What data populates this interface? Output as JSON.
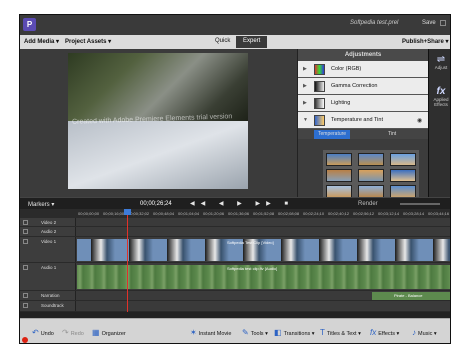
{
  "window": {
    "doc_title": "Softpedia test.prel",
    "save_label": "Save",
    "app_icon": "premiere-elements-icon"
  },
  "menu": {
    "add_media": "Add Media ▾",
    "project_assets": "Project Assets ▾",
    "quick": "Quick",
    "expert": "Expert",
    "publish_share": "Publish+Share ▾"
  },
  "monitor": {
    "watermark": "Created with Adobe Premiere Elements trial version"
  },
  "adjustments": {
    "title": "Adjustments",
    "items": [
      {
        "label": "Color (RGB)"
      },
      {
        "label": "Gamma Correction"
      },
      {
        "label": "Lighting"
      },
      {
        "label": "Temperature and Tint"
      }
    ],
    "tabs": [
      "Temperature",
      "Tint"
    ]
  },
  "rail": {
    "adjust": "Adjust",
    "applied_effects": "Applied Effects"
  },
  "timeline_bar": {
    "markers": "Markers ▾",
    "timecode": "00;00;26;24",
    "render": "Render"
  },
  "ruler": [
    "00;00;00;00",
    "00;00;16;00",
    "00;00;32;02",
    "00;00;48;04",
    "00;01;04;04",
    "00;01;20;06",
    "00;01;36;06",
    "00;01;52;08",
    "00;02;08;08",
    "00;02;24;10",
    "00;02;40;12",
    "00;02;56;12",
    "00;03;12;14",
    "00;03;28;14",
    "00;03;44;16"
  ],
  "tracks": [
    "Video 2",
    "Audio 2",
    "Video 1",
    "Audio 1",
    "Narration",
    "Soundtrack"
  ],
  "clip_labels": [
    "Softpedia Test Clip [Video]",
    "Softpedia test clip.flv [Audio]",
    "Pirate - Balance"
  ],
  "bottom": {
    "undo": "Undo",
    "redo": "Redo",
    "organizer": "Organizer",
    "instant_movie": "Instant Movie",
    "tools": "Tools ▾",
    "transitions": "Transitions ▾",
    "titles_text": "Titles & Text ▾",
    "effects": "Effects ▾",
    "music": "Music ▾"
  },
  "colors": {
    "accent": "#3d7bd8",
    "video_clip": "#6f8fb8",
    "audio_clip": "#5d8a4e",
    "playhead": "#e0312a"
  }
}
